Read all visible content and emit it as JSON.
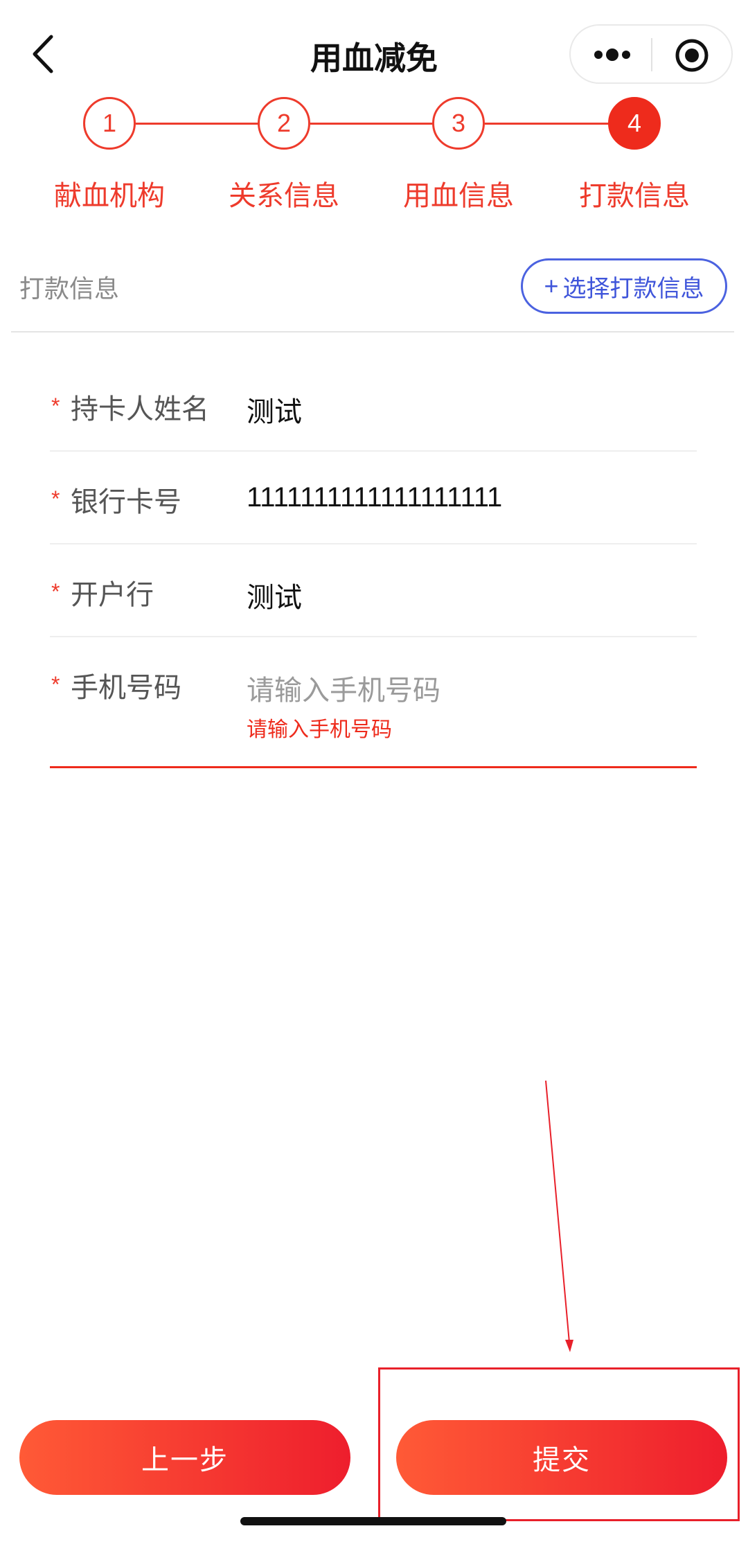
{
  "header": {
    "title": "用血减免",
    "back_icon": "chevron-left-icon",
    "more_icon": "more-dots-icon",
    "close_icon": "target-circle-icon"
  },
  "stepper": {
    "steps": [
      {
        "number": "1",
        "label": "献血机构",
        "active": false
      },
      {
        "number": "2",
        "label": "关系信息",
        "active": false
      },
      {
        "number": "3",
        "label": "用血信息",
        "active": false
      },
      {
        "number": "4",
        "label": "打款信息",
        "active": true
      }
    ]
  },
  "section": {
    "title": "打款信息",
    "select_button_label": "选择打款信息",
    "select_button_icon": "plus-icon"
  },
  "form": {
    "fields": [
      {
        "label": "持卡人姓名",
        "value": "测试",
        "required_mark": "*"
      },
      {
        "label": "银行卡号",
        "value": "1111111111111111111",
        "required_mark": "*"
      },
      {
        "label": "开户行",
        "value": "测试",
        "required_mark": "*"
      },
      {
        "label": "手机号码",
        "value": "",
        "placeholder": "请输入手机号码",
        "error": "请输入手机号码",
        "required_mark": "*"
      }
    ]
  },
  "footer": {
    "prev_label": "上一步",
    "submit_label": "提交"
  },
  "colors": {
    "accent": "#ee2b1c",
    "link": "#3f55da",
    "gradient_start": "#ff5a36",
    "gradient_end": "#ee1e2d"
  }
}
